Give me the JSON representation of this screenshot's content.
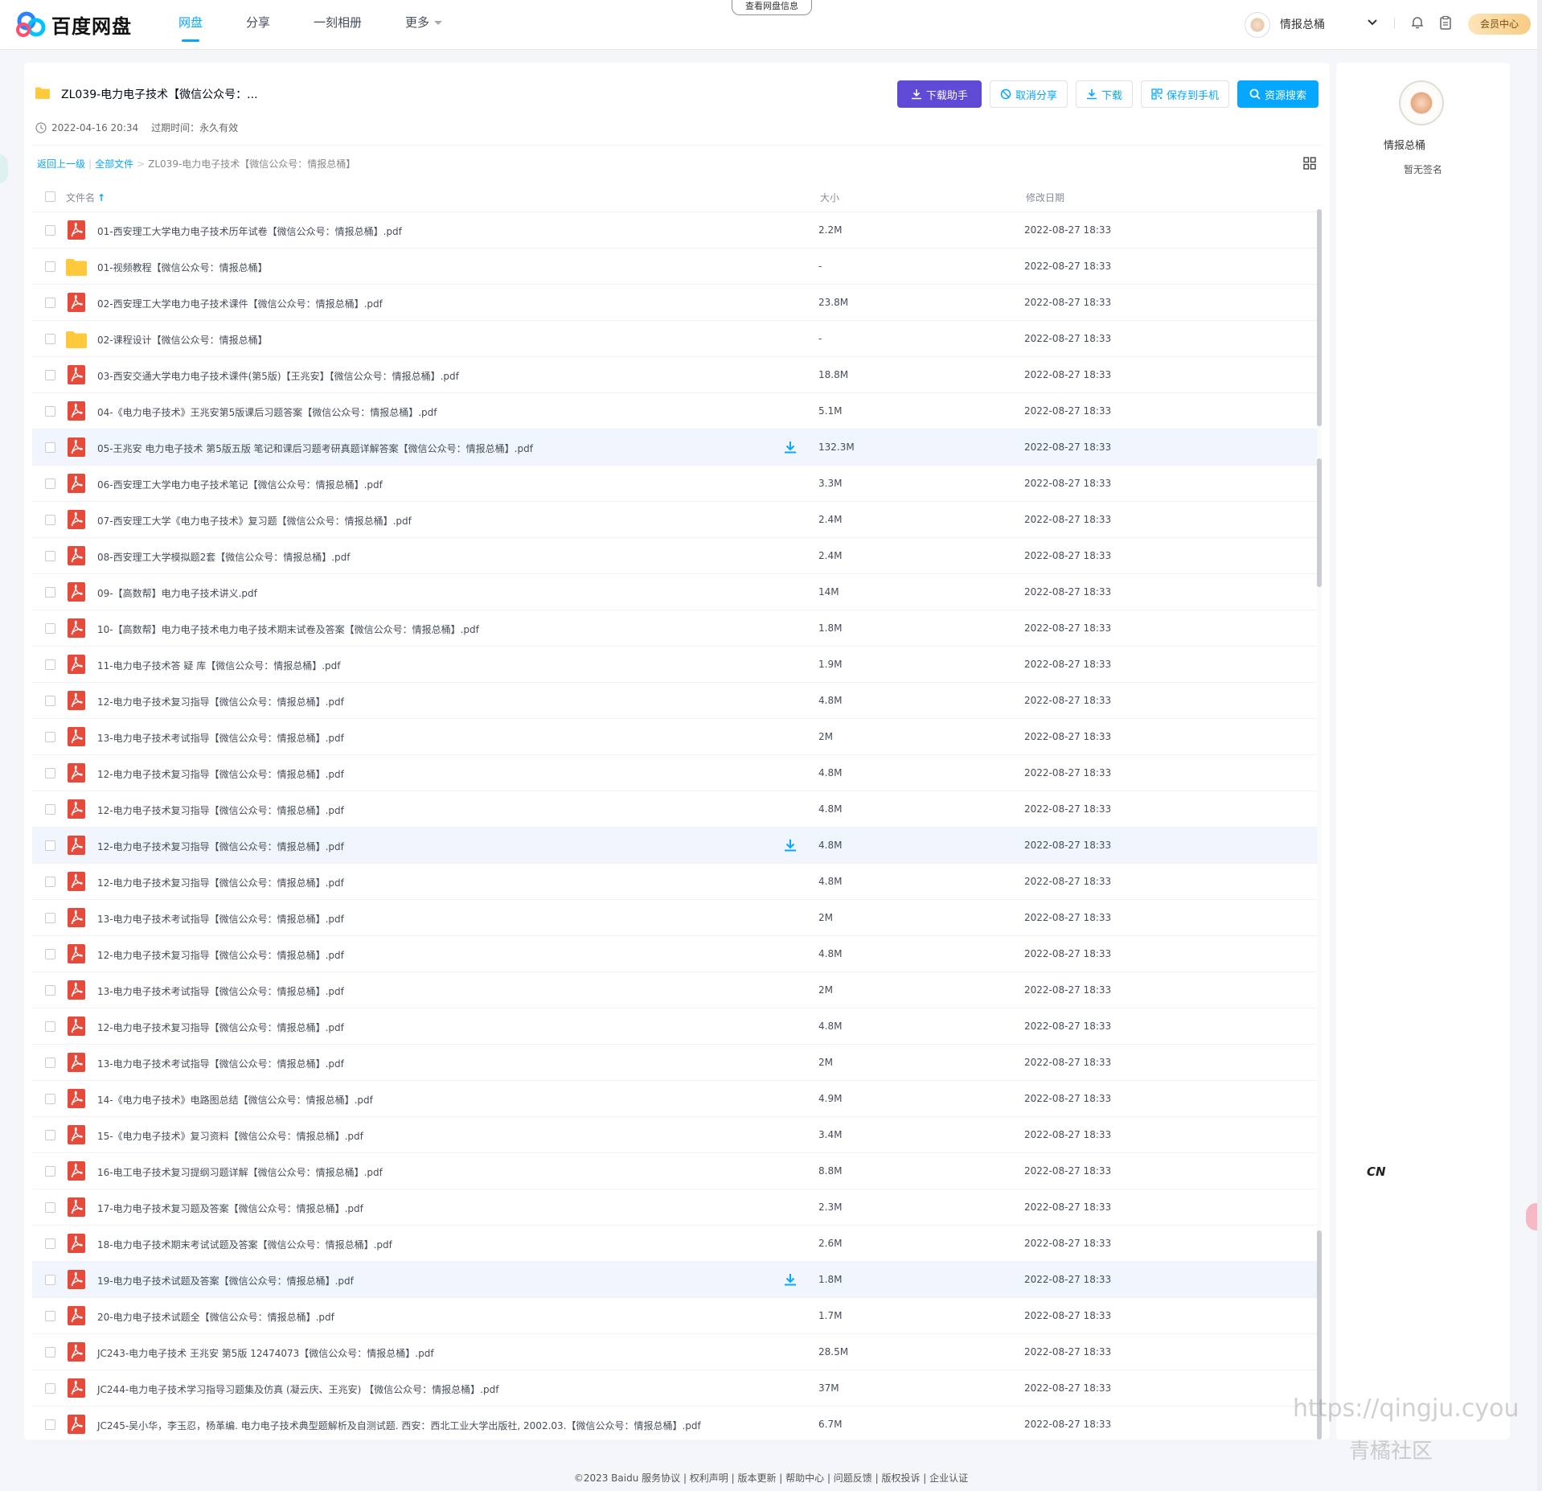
{
  "app": {
    "brand": "百度网盘",
    "nav": [
      {
        "label": "网盘",
        "active": true
      },
      {
        "label": "分享",
        "active": false
      },
      {
        "label": "一刻相册",
        "active": false
      },
      {
        "label": "更多",
        "active": false
      }
    ],
    "view_info": "查看网盘信息",
    "user_name": "情报总桶",
    "vip_label": "会员中心"
  },
  "share": {
    "title": "ZL039-电力电子技术【微信公众号：...",
    "created": "2022-04-16 20:34",
    "expire": "过期时间：永久有效",
    "buttons": {
      "download_helper": "下载助手",
      "cancel_share": "取消分享",
      "download": "下载",
      "save_phone": "保存到手机",
      "resource_search": "资源搜索"
    },
    "breadcrumb": {
      "back": "返回上一级",
      "all": "全部文件",
      "current": "ZL039-电力电子技术【微信公众号：情报总桶】"
    },
    "columns": {
      "name": "文件名",
      "size": "大小",
      "date": "修改日期"
    }
  },
  "files": [
    {
      "name": "01-西安理工大学电力电子技术历年试卷【微信公众号：情报总桶】.pdf",
      "size": "2.2M",
      "date": "2022-08-27 18:33",
      "type": "pdf",
      "hover": false
    },
    {
      "name": "01-视频教程【微信公众号：情报总桶】",
      "size": "-",
      "date": "2022-08-27 18:33",
      "type": "folder",
      "hover": false
    },
    {
      "name": "02-西安理工大学电力电子技术课件【微信公众号：情报总桶】.pdf",
      "size": "23.8M",
      "date": "2022-08-27 18:33",
      "type": "pdf",
      "hover": false
    },
    {
      "name": "02-课程设计【微信公众号：情报总桶】",
      "size": "-",
      "date": "2022-08-27 18:33",
      "type": "folder",
      "hover": false
    },
    {
      "name": "03-西安交通大学电力电子技术课件(第5版)【王兆安】【微信公众号：情报总桶】.pdf",
      "size": "18.8M",
      "date": "2022-08-27 18:33",
      "type": "pdf",
      "hover": false
    },
    {
      "name": "04-《电力电子技术》王兆安第5版课后习题答案【微信公众号：情报总桶】.pdf",
      "size": "5.1M",
      "date": "2022-08-27 18:33",
      "type": "pdf",
      "hover": false
    },
    {
      "name": "05-王兆安 电力电子技术 第5版五版 笔记和课后习题考研真题详解答案【微信公众号：情报总桶】.pdf",
      "size": "132.3M",
      "date": "2022-08-27 18:33",
      "type": "pdf",
      "hover": true
    },
    {
      "name": "06-西安理工大学电力电子技术笔记【微信公众号：情报总桶】.pdf",
      "size": "3.3M",
      "date": "2022-08-27 18:33",
      "type": "pdf",
      "hover": false
    },
    {
      "name": "07-西安理工大学《电力电子技术》复习题【微信公众号：情报总桶】.pdf",
      "size": "2.4M",
      "date": "2022-08-27 18:33",
      "type": "pdf",
      "hover": false
    },
    {
      "name": "08-西安理工大学模拟题2套【微信公众号：情报总桶】.pdf",
      "size": "2.4M",
      "date": "2022-08-27 18:33",
      "type": "pdf",
      "hover": false
    },
    {
      "name": "09-【高数帮】电力电子技术讲义.pdf",
      "size": "14M",
      "date": "2022-08-27 18:33",
      "type": "pdf",
      "hover": false
    },
    {
      "name": "10-【高数帮】电力电子技术电力电子技术期末试卷及答案【微信公众号：情报总桶】.pdf",
      "size": "1.8M",
      "date": "2022-08-27 18:33",
      "type": "pdf",
      "hover": false
    },
    {
      "name": "11-电力电子技术答 疑 库【微信公众号：情报总桶】.pdf",
      "size": "1.9M",
      "date": "2022-08-27 18:33",
      "type": "pdf",
      "hover": false
    },
    {
      "name": "12-电力电子技术复习指导【微信公众号：情报总桶】.pdf",
      "size": "4.8M",
      "date": "2022-08-27 18:33",
      "type": "pdf",
      "hover": false
    },
    {
      "name": "13-电力电子技术考试指导【微信公众号：情报总桶】.pdf",
      "size": "2M",
      "date": "2022-08-27 18:33",
      "type": "pdf",
      "hover": false
    },
    {
      "name": "12-电力电子技术复习指导【微信公众号：情报总桶】.pdf",
      "size": "4.8M",
      "date": "2022-08-27 18:33",
      "type": "pdf",
      "hover": false
    },
    {
      "name": "12-电力电子技术复习指导【微信公众号：情报总桶】.pdf",
      "size": "4.8M",
      "date": "2022-08-27 18:33",
      "type": "pdf",
      "hover": false
    },
    {
      "name": "12-电力电子技术复习指导【微信公众号：情报总桶】.pdf",
      "size": "4.8M",
      "date": "2022-08-27 18:33",
      "type": "pdf",
      "hover": true
    },
    {
      "name": "12-电力电子技术复习指导【微信公众号：情报总桶】.pdf",
      "size": "4.8M",
      "date": "2022-08-27 18:33",
      "type": "pdf",
      "hover": false
    },
    {
      "name": "13-电力电子技术考试指导【微信公众号：情报总桶】.pdf",
      "size": "2M",
      "date": "2022-08-27 18:33",
      "type": "pdf",
      "hover": false
    },
    {
      "name": "12-电力电子技术复习指导【微信公众号：情报总桶】.pdf",
      "size": "4.8M",
      "date": "2022-08-27 18:33",
      "type": "pdf",
      "hover": false
    },
    {
      "name": "13-电力电子技术考试指导【微信公众号：情报总桶】.pdf",
      "size": "2M",
      "date": "2022-08-27 18:33",
      "type": "pdf",
      "hover": false
    },
    {
      "name": "12-电力电子技术复习指导【微信公众号：情报总桶】.pdf",
      "size": "4.8M",
      "date": "2022-08-27 18:33",
      "type": "pdf",
      "hover": false
    },
    {
      "name": "13-电力电子技术考试指导【微信公众号：情报总桶】.pdf",
      "size": "2M",
      "date": "2022-08-27 18:33",
      "type": "pdf",
      "hover": false
    },
    {
      "name": "14-《电力电子技术》电路图总结【微信公众号：情报总桶】.pdf",
      "size": "4.9M",
      "date": "2022-08-27 18:33",
      "type": "pdf",
      "hover": false
    },
    {
      "name": "15-《电力电子技术》复习资料【微信公众号：情报总桶】.pdf",
      "size": "3.4M",
      "date": "2022-08-27 18:33",
      "type": "pdf",
      "hover": false
    },
    {
      "name": "16-电工电子技术复习提纲习题详解【微信公众号：情报总桶】.pdf",
      "size": "8.8M",
      "date": "2022-08-27 18:33",
      "type": "pdf",
      "hover": false
    },
    {
      "name": "17-电力电子技术复习题及答案【微信公众号：情报总桶】.pdf",
      "size": "2.3M",
      "date": "2022-08-27 18:33",
      "type": "pdf",
      "hover": false
    },
    {
      "name": "18-电力电子技术期末考试试题及答案【微信公众号：情报总桶】.pdf",
      "size": "2.6M",
      "date": "2022-08-27 18:33",
      "type": "pdf",
      "hover": false
    },
    {
      "name": "19-电力电子技术试题及答案【微信公众号：情报总桶】.pdf",
      "size": "1.8M",
      "date": "2022-08-27 18:33",
      "type": "pdf",
      "hover": true
    },
    {
      "name": "20-电力电子技术试题全【微信公众号：情报总桶】.pdf",
      "size": "1.7M",
      "date": "2022-08-27 18:33",
      "type": "pdf",
      "hover": false
    },
    {
      "name": "JC243-电力电子技术 王兆安 第5版 12474073【微信公众号：情报总桶】.pdf",
      "size": "28.5M",
      "date": "2022-08-27 18:33",
      "type": "pdf",
      "hover": false
    },
    {
      "name": "JC244-电力电子技术学习指导习题集及仿真 (凝云庆、王兆安) 【微信公众号：情报总桶】.pdf",
      "size": "37M",
      "date": "2022-08-27 18:33",
      "type": "pdf",
      "hover": false
    },
    {
      "name": "JC245-吴小华，李玉忍，杨革编. 电力电子技术典型题解析及自测试题. 西安：西北工业大学出版社, 2002.03.【微信公众号：情报总桶】.pdf",
      "size": "6.7M",
      "date": "2022-08-27 18:33",
      "type": "pdf",
      "hover": false
    }
  ],
  "side": {
    "name": "情报总桶",
    "sign": "暂无签名"
  },
  "lang_badge": "CN",
  "footer": "©2023 Baidu  服务协议 | 权利声明 | 版本更新 | 帮助中心 | 问题反馈 | 版权投诉 | 企业认证",
  "watermark": {
    "url": "https://qingju.cyou",
    "name": "青橘社区"
  },
  "colors": {
    "accent": "#06a7ff",
    "purple": "#5f4ad6",
    "pdf": "#e64a3b",
    "folder": "#ffc93c"
  }
}
